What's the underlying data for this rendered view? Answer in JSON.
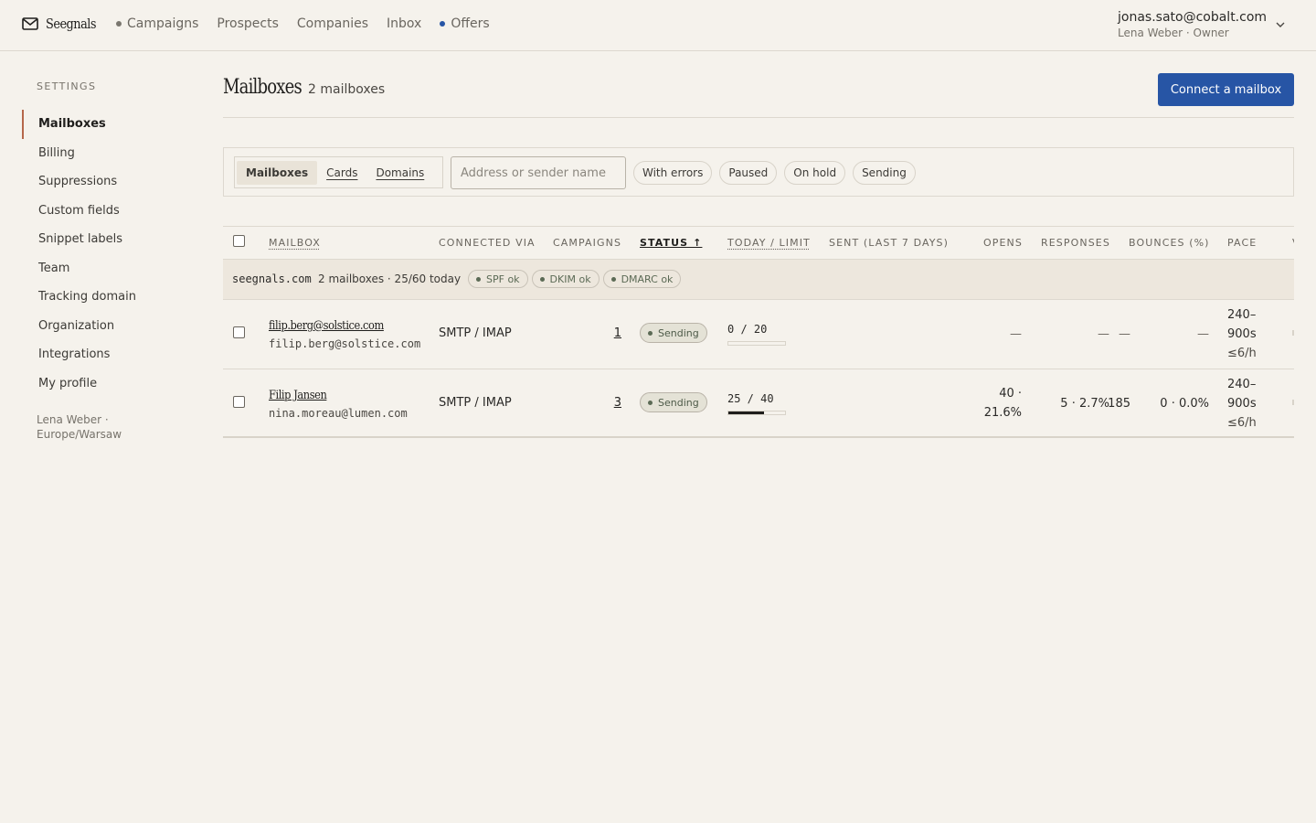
{
  "app": {
    "brand": "Seegnals",
    "nav": [
      {
        "label": "Campaigns",
        "dot": "#7a776f"
      },
      {
        "label": "Prospects",
        "dot": null
      },
      {
        "label": "Companies",
        "dot": null
      },
      {
        "label": "Inbox",
        "dot": null
      },
      {
        "label": "Offers",
        "dot": "#2755a5"
      }
    ],
    "user": {
      "email": "jonas.sato@cobalt.com",
      "sub": "Lena Weber · Owner"
    }
  },
  "sidebar": {
    "heading": "SETTINGS",
    "items": [
      {
        "label": "Mailboxes",
        "active": true
      },
      {
        "label": "Billing"
      },
      {
        "label": "Suppressions"
      },
      {
        "label": "Custom fields"
      },
      {
        "label": "Snippet labels"
      },
      {
        "label": "Team"
      },
      {
        "label": "Tracking domain"
      },
      {
        "label": "Organization"
      },
      {
        "label": "Integrations"
      },
      {
        "label": "My profile"
      }
    ],
    "footer": "Lena Weber · Europe/Warsaw"
  },
  "page": {
    "title": "Mailboxes",
    "count": "2 mailboxes",
    "connect_button": "Connect a mailbox"
  },
  "filters": {
    "views": [
      "Mailboxes",
      "Cards",
      "Domains"
    ],
    "active_view": "Mailboxes",
    "search_placeholder": "Address or sender name",
    "search_value": "",
    "chips": [
      "With errors",
      "Paused",
      "On hold",
      "Sending"
    ]
  },
  "table": {
    "columns": {
      "mailbox": "MAILBOX",
      "connected_via": "CONNECTED VIA",
      "campaigns": "CAMPAIGNS",
      "status": "STATUS ↑",
      "today_limit": "TODAY / LIMIT",
      "sent7": "SENT (LAST 7 DAYS)",
      "opens": "OPENS",
      "responses": "RESPONSES",
      "bounces": "BOUNCES (%)",
      "pace": "PACE",
      "overflow": "V"
    },
    "group": {
      "domain": "seegnals.com",
      "meta": "2 mailboxes · 25/60 today",
      "dns": [
        "SPF ok",
        "DKIM ok",
        "DMARC ok"
      ]
    },
    "rows": [
      {
        "name": "filip.berg@solstice.com",
        "address": "filip.berg@solstice.com",
        "via": "SMTP / IMAP",
        "campaigns": "1",
        "status": "Sending",
        "today": "0 / 20",
        "today_fraction": 0.0,
        "sent7": "—",
        "opens": [
          "—"
        ],
        "responses": "—",
        "bounces": "—",
        "pace": [
          "240–",
          "900s",
          "≤6/h"
        ]
      },
      {
        "name": "Filip Jansen",
        "address": "nina.moreau@lumen.com",
        "via": "SMTP / IMAP",
        "campaigns": "3",
        "status": "Sending",
        "today": "25 / 40",
        "today_fraction": 0.625,
        "sent7": "185",
        "opens": [
          "40 ·",
          "21.6%"
        ],
        "responses": "5 · 2.7%",
        "bounces": "0 · 0.0%",
        "pace": [
          "240–",
          "900s",
          "≤6/h"
        ]
      }
    ]
  }
}
